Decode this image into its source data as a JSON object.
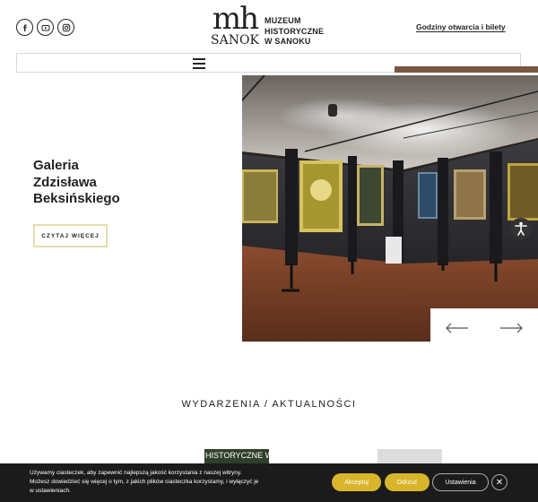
{
  "header": {
    "social": [
      {
        "name": "facebook",
        "icon": "facebook-icon"
      },
      {
        "name": "youtube",
        "icon": "youtube-icon"
      },
      {
        "name": "instagram",
        "icon": "instagram-icon"
      }
    ],
    "logo": {
      "mark": "mh",
      "city": "SANOK",
      "line1": "MUZEUM",
      "line2": "HISTORYCZNE",
      "line3": "W SANOKU"
    },
    "hours_link": "Godziny otwarcia i bilety",
    "menu_icon": "hamburger-icon"
  },
  "hero": {
    "title_line1": "Galeria",
    "title_line2": "Zdzisława",
    "title_line3": "Beksińskiego",
    "read_more": "CZYTAJ WIĘCEJ",
    "prev_icon": "arrow-left-icon",
    "next_icon": "arrow-right-icon"
  },
  "accessibility_icon": "accessibility-icon",
  "section": {
    "title": "WYDARZENIA / AKTUALNOŚCI"
  },
  "news_thumbs": [
    {
      "text": "HISTORYCZNE W"
    }
  ],
  "cookie": {
    "line1": "Używamy ciasteczek, aby zapewnić najlepszą jakość korzystania z naszej witryny.",
    "line2": "Możesz dowiedzieć się więcej o tym, z jakich plików ciasteczka korzystamy, i wyłączyć je",
    "line3": "w ustawieniach.",
    "accept": "Akceptuj",
    "reject": "Odrzuć",
    "settings": "Ustawienia",
    "close": "✕"
  },
  "colors": {
    "accent_yellow": "#d9b52b",
    "brown": "#7a5541",
    "cookie_bg": "#1b1b1b"
  }
}
